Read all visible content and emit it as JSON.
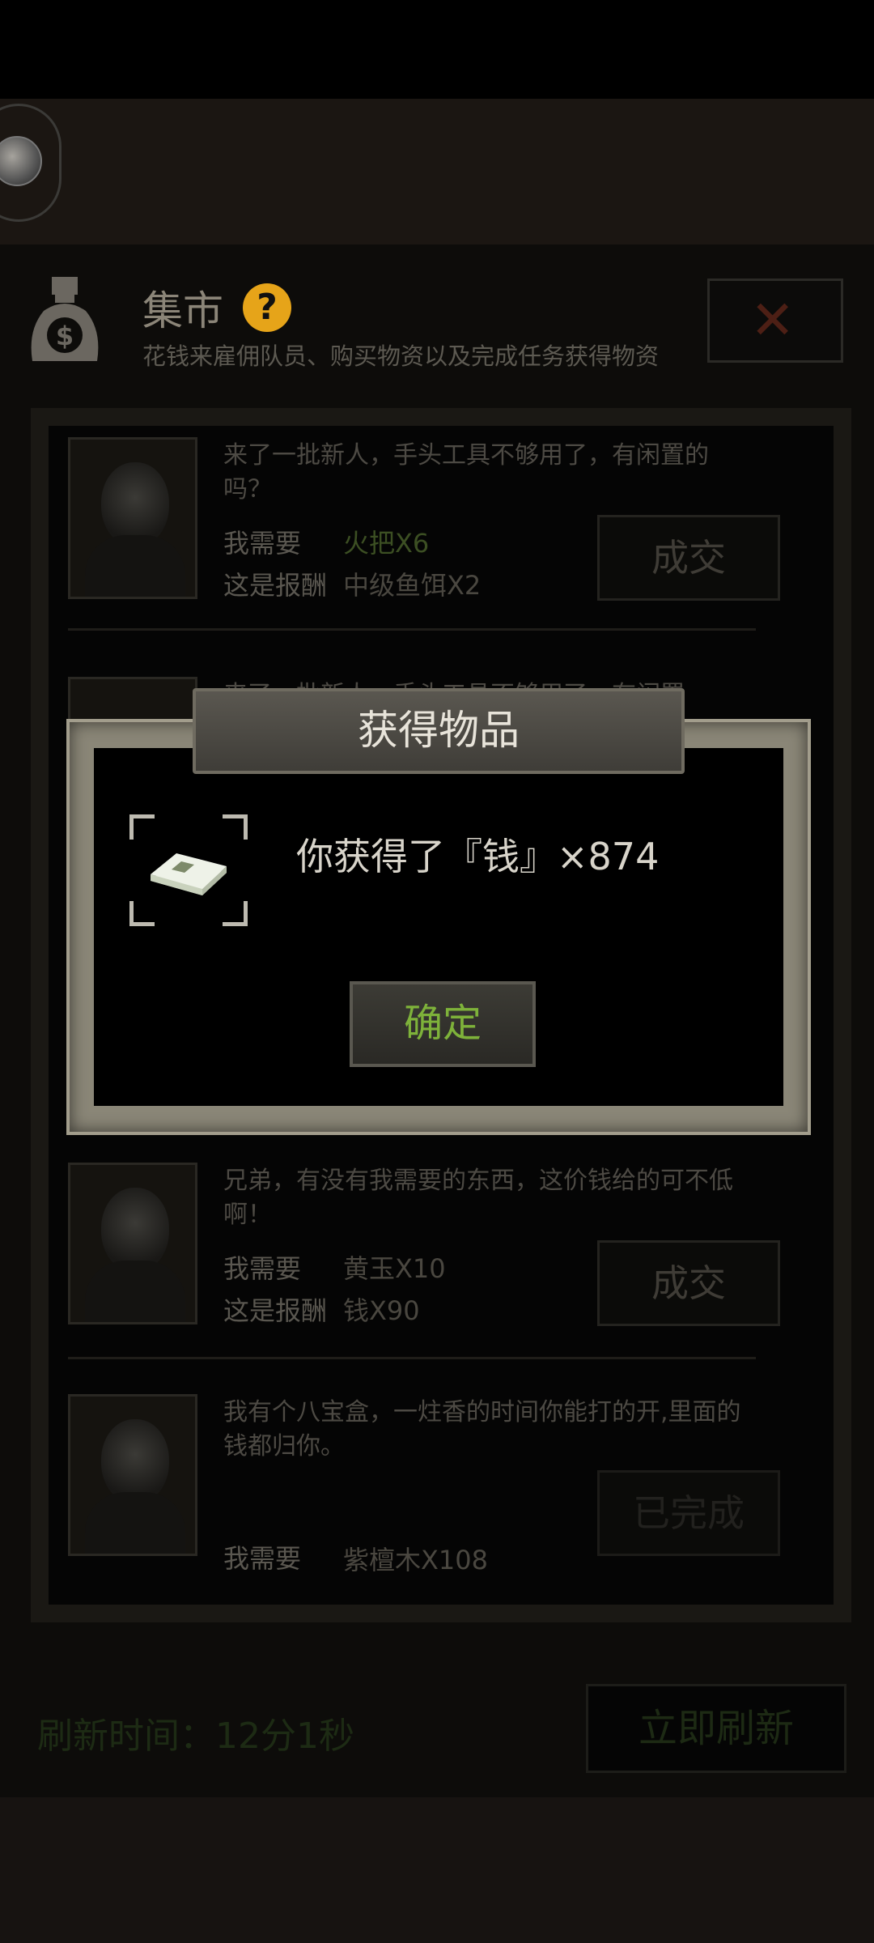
{
  "header": {
    "avatar_icon": "avatar"
  },
  "market": {
    "title": "集市",
    "subtitle": "花钱来雇佣队员、购买物资以及完成任务获得物资",
    "help_icon": "question-icon",
    "close_icon": "close-icon"
  },
  "requests": [
    {
      "text": "来了一批新人，手头工具不够用了，有闲置的吗？",
      "need_label": "我需要",
      "need_value": "火把X6",
      "need_color": "#3c4f23",
      "reward_label": "这是报酬",
      "reward_value": "中级鱼饵X2",
      "button": "成交"
    },
    {
      "text": "来了一批新人，手头工具不够用了，有闲置",
      "partial": true
    },
    {
      "text": "兄弟，有没有我需要的东西，这价钱给的可不低啊！",
      "need_label": "我需要",
      "need_value": "黄玉X10",
      "need_color": "#4a4740",
      "reward_label": "这是报酬",
      "reward_value": "钱X90",
      "button": "成交"
    },
    {
      "text": "我有个八宝盒，一炷香的时间你能打的开,里面的钱都归你。",
      "need_label": "我需要",
      "need_value": "紫檀木X108",
      "need_color": "#4a4740",
      "button": "已完成"
    }
  ],
  "footer": {
    "refresh_time": "刷新时间：12分1秒",
    "refresh_button": "立即刷新"
  },
  "dialog": {
    "title": "获得物品",
    "message": "你获得了『钱』×874",
    "item_icon": "money-stack-icon",
    "ok_button": "确定"
  }
}
